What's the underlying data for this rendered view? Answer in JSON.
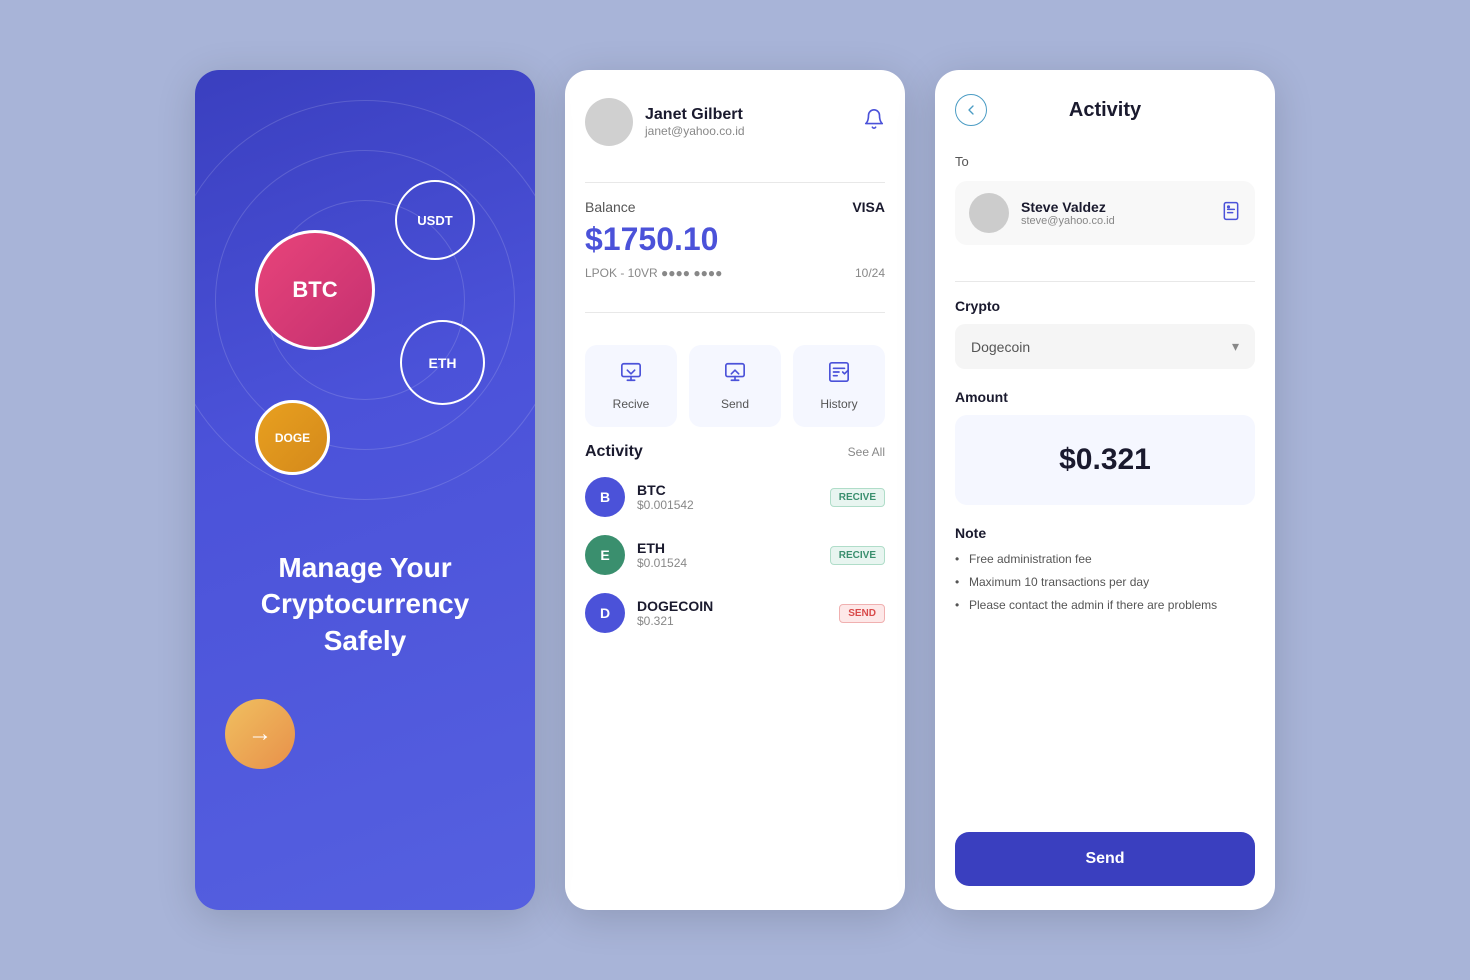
{
  "bg_color": "#a8b4d8",
  "screen1": {
    "coins": [
      {
        "id": "btc",
        "label": "BTC",
        "style": "coin-btc"
      },
      {
        "id": "usdt",
        "label": "USDT",
        "style": "coin-usdt"
      },
      {
        "id": "eth",
        "label": "ETH",
        "style": "coin-eth"
      },
      {
        "id": "doge",
        "label": "DOGE",
        "style": "coin-doge"
      }
    ],
    "headline": "Manage Your Cryptocurrency Safely",
    "arrow_label": "→"
  },
  "screen2": {
    "profile": {
      "name": "Janet Gilbert",
      "email": "janet@yahoo.co.id"
    },
    "balance": {
      "label": "Balance",
      "visa_label": "VISA",
      "amount": "$1750.10",
      "card_number": "LPOK - 10VR  ●●●●  ●●●●",
      "expiry": "10/24"
    },
    "actions": [
      {
        "id": "receive",
        "label": "Recive"
      },
      {
        "id": "send",
        "label": "Send"
      },
      {
        "id": "history",
        "label": "History"
      }
    ],
    "activity": {
      "title": "Activity",
      "see_all": "See All",
      "transactions": [
        {
          "id": "btc",
          "icon_letter": "B",
          "name": "BTC",
          "amount": "$0.001542",
          "badge": "RECIVE",
          "type": "receive"
        },
        {
          "id": "eth",
          "icon_letter": "E",
          "name": "ETH",
          "amount": "$0.01524",
          "badge": "RECIVE",
          "type": "receive"
        },
        {
          "id": "doge",
          "icon_letter": "D",
          "name": "DOGECOIN",
          "amount": "$0.321",
          "badge": "SEND",
          "type": "send"
        }
      ]
    }
  },
  "screen3": {
    "title": "Activity",
    "back_label": "←",
    "to_label": "To",
    "recipient": {
      "name": "Steve Valdez",
      "email": "steve@yahoo.co.id"
    },
    "crypto_label": "Crypto",
    "crypto_value": "Dogecoin",
    "amount_label": "Amount",
    "amount_value": "$0.321",
    "note_label": "Note",
    "notes": [
      "Free administration fee",
      "Maximum 10 transactions per day",
      "Please contact the admin if there are problems"
    ],
    "send_button": "Send"
  }
}
